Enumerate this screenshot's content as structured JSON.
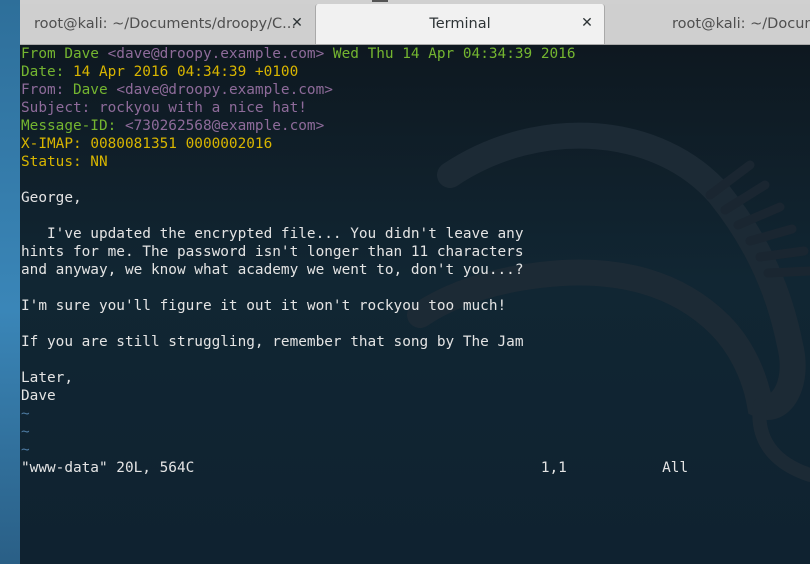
{
  "tabs": [
    {
      "title": "root@kali: ~/Documents/droopy/C..."
    },
    {
      "title": "Terminal"
    },
    {
      "title": "root@kali: ~/Docum"
    }
  ],
  "close_glyph": "✕",
  "terminal": {
    "lines": [
      [
        {
          "t": "From Dave ",
          "c": "green"
        },
        {
          "t": "<dave@droopy.example.com>",
          "c": "purple"
        },
        {
          "t": " Wed Thu 14 Apr 04:34:39 2016",
          "c": "green"
        }
      ],
      [
        {
          "t": "Date: ",
          "c": "green"
        },
        {
          "t": "14 Apr 2016 04:34:39 +0100",
          "c": "yellow"
        }
      ],
      [
        {
          "t": "From: ",
          "c": "purple"
        },
        {
          "t": "Dave ",
          "c": "green"
        },
        {
          "t": "<dave@droopy.example.com>",
          "c": "purple"
        }
      ],
      [
        {
          "t": "Subject: rockyou with a nice hat!",
          "c": "purple"
        }
      ],
      [
        {
          "t": "Message-ID: ",
          "c": "green"
        },
        {
          "t": "<730262568@example.com>",
          "c": "purple"
        }
      ],
      [
        {
          "t": "X-IMAP: ",
          "c": "yellow"
        },
        {
          "t": "0080081351 0000002016",
          "c": "yellow"
        }
      ],
      [
        {
          "t": "Status: NN",
          "c": "yellow"
        }
      ],
      [],
      [
        {
          "t": "George,",
          "c": "white"
        }
      ],
      [],
      [
        {
          "t": "   I've updated the encrypted file... You didn't leave any",
          "c": "white"
        }
      ],
      [
        {
          "t": "hints for me. The password isn't longer than 11 characters",
          "c": "white"
        }
      ],
      [
        {
          "t": "and anyway, we know what academy we went to, don't you...?",
          "c": "white"
        }
      ],
      [],
      [
        {
          "t": "I'm sure you'll figure it out it won't rockyou too much!",
          "c": "white"
        }
      ],
      [],
      [
        {
          "t": "If you are still struggling, remember that song by The Jam",
          "c": "white"
        }
      ],
      [],
      [
        {
          "t": "Later,",
          "c": "white"
        }
      ],
      [
        {
          "t": "Dave",
          "c": "white"
        }
      ],
      [
        {
          "t": "~",
          "c": "tilde"
        }
      ],
      [
        {
          "t": "~",
          "c": "tilde"
        }
      ],
      [
        {
          "t": "~",
          "c": "tilde"
        }
      ],
      [
        {
          "t": "\"www-data\" 20L, 564C                                        1,1           All",
          "c": "white"
        }
      ]
    ]
  },
  "colors": {
    "green": "#74b530",
    "yellow": "#d8b500",
    "purple": "#8e6b9a",
    "white": "#e4e4e4",
    "tilde": "#4d7aa1"
  }
}
